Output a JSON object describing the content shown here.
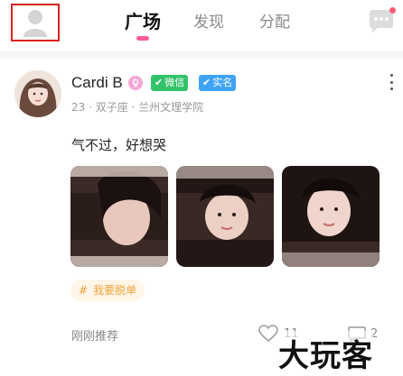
{
  "header": {
    "tabs": [
      {
        "label": "广场",
        "active": true
      },
      {
        "label": "发现",
        "active": false
      },
      {
        "label": "分配",
        "active": false
      }
    ],
    "accent_color": "#ff5b9a"
  },
  "post": {
    "username": "Cardi B",
    "badges": {
      "wechat": "微信",
      "realname": "实名"
    },
    "meta": "23 · 双子座 · 兰州文理学院",
    "text": "气不过，好想哭",
    "topic_tag": "我要脱单",
    "time": "刚刚推荐",
    "like_count": "11",
    "comment_count": "2"
  },
  "watermark": "大玩客",
  "icons": {
    "profile": "profile-avatar-icon",
    "chat": "chat-bubble-icon",
    "more": "more-vertical-icon",
    "like": "heart-icon",
    "comment": "comment-icon"
  }
}
